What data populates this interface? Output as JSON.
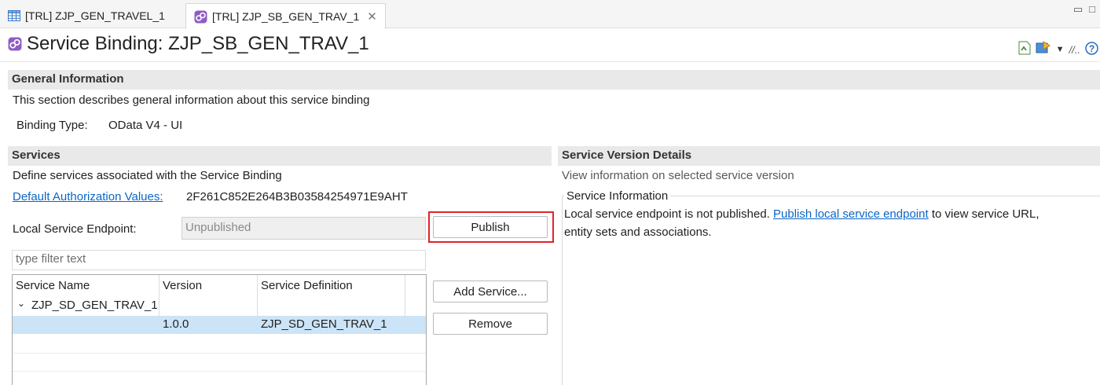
{
  "tabs": [
    {
      "label": "[TRL] ZJP_GEN_TRAVEL_1",
      "icon": "table-icon"
    },
    {
      "label": "[TRL] ZJP_SB_GEN_TRAV_1",
      "icon": "service-binding-icon",
      "active": true
    }
  ],
  "header": {
    "title": "Service Binding: ZJP_SB_GEN_TRAV_1",
    "tools": [
      "refresh-icon",
      "publish-tool-icon",
      "dropdown-icon",
      "link-icon",
      "help-icon"
    ]
  },
  "general": {
    "heading": "General Information",
    "description": "This section describes general information about this service binding",
    "binding_type_label": "Binding Type:",
    "binding_type_value": "OData V4 - UI"
  },
  "services": {
    "heading": "Services",
    "description": "Define services associated with the Service Binding",
    "auth_link": "Default Authorization Values:",
    "auth_value": "2F261C852E264B3B03584254971E9AHT",
    "endpoint_label": "Local Service Endpoint:",
    "endpoint_value": "Unpublished",
    "publish_button": "Publish",
    "filter_placeholder": "type filter text",
    "add_button": "Add Service...",
    "remove_button": "Remove",
    "columns": [
      "Service Name",
      "Version",
      "Service Definition"
    ],
    "group_row": "ZJP_SD_GEN_TRAV_1",
    "rows": [
      {
        "name": "",
        "version": "1.0.0",
        "definition": "ZJP_SD_GEN_TRAV_1",
        "selected": true
      }
    ]
  },
  "details": {
    "heading": "Service Version Details",
    "description": "View information on selected service version",
    "info_title": "Service Information",
    "info_text_before": "Local service endpoint is not published.",
    "info_link": "Publish local service endpoint",
    "info_text_after": "to view service URL,",
    "info_text_line2": "entity sets and associations."
  },
  "colors": {
    "accent": "#0a66c8",
    "selection": "#cce4f7",
    "highlight": "#e0242b",
    "section_bg": "#e9e9e9"
  }
}
